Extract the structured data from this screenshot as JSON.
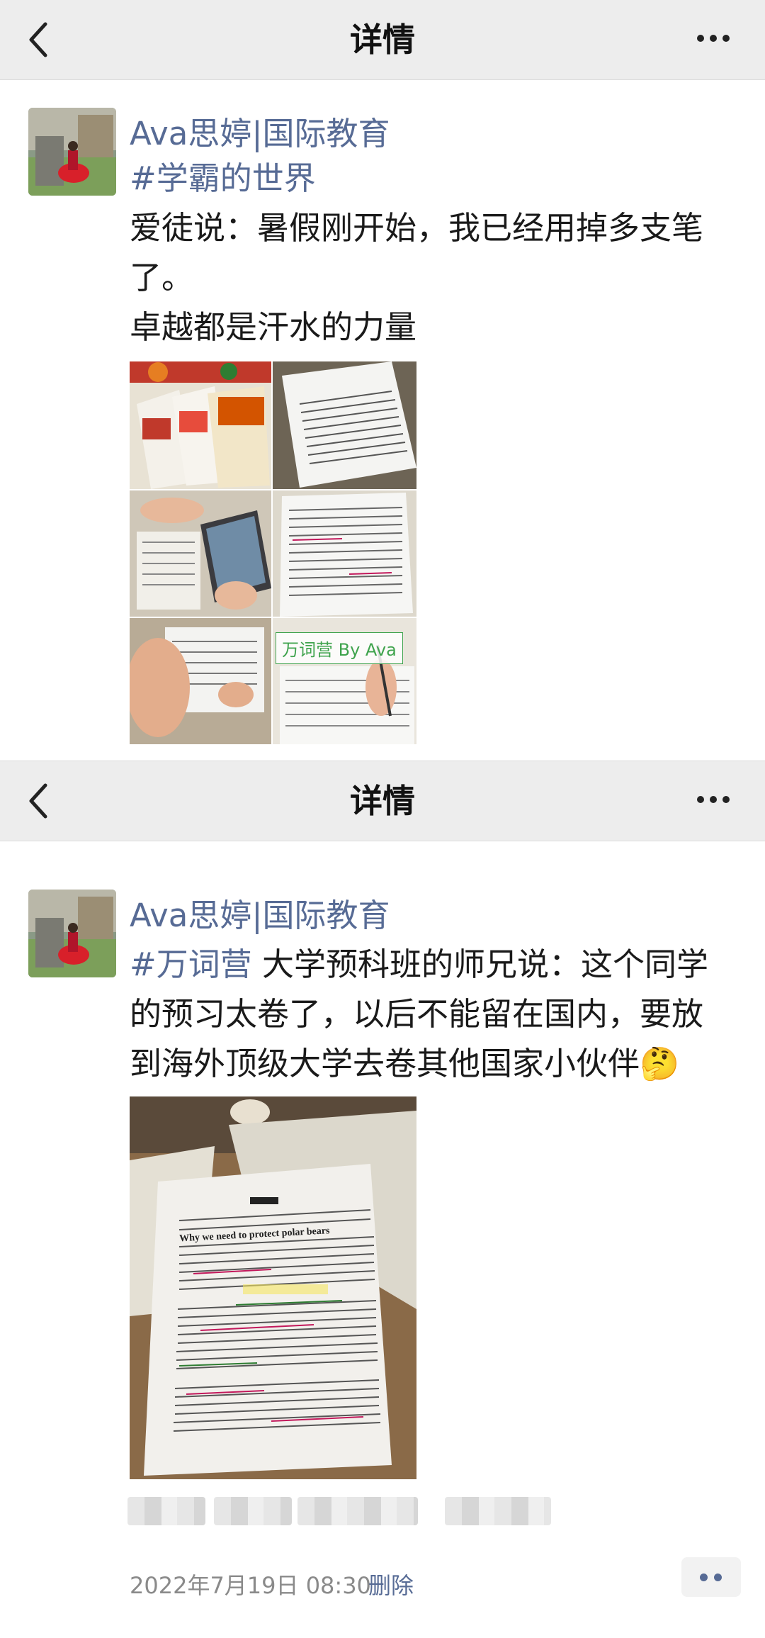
{
  "screens": [
    {
      "header": {
        "title": "详情"
      },
      "post": {
        "author": "Ava思婷|国际教育",
        "hashtag": "#学霸的世界",
        "text_lines": [
          "爱徒说：暑假刚开始，我已经用掉多支笔",
          "了。",
          "卓越都是汗水的力量"
        ],
        "watermark": "万词营 By Ava"
      }
    },
    {
      "header": {
        "title": "详情"
      },
      "post": {
        "author": "Ava思婷|国际教育",
        "hashtag": "#万词营",
        "text_first": " 大学预科班的师兄说：这个同学",
        "text_lines": [
          "的预习太卷了，以后不能留在国内，要放",
          "到海外顶级大学去卷其他国家小伙伴"
        ],
        "emoji": "🤔",
        "photo_heading": "Why we need to protect polar bears",
        "timestamp": "2022年7月19日 08:30",
        "delete_label": "删除"
      }
    }
  ],
  "icons": [
    "back-arrow-icon",
    "more-dots-icon",
    "comment-dots-icon"
  ],
  "colors": {
    "nav_bg": "#ededed",
    "link": "#576b95",
    "text": "#1a1a1a",
    "meta": "#8a8a8a"
  }
}
